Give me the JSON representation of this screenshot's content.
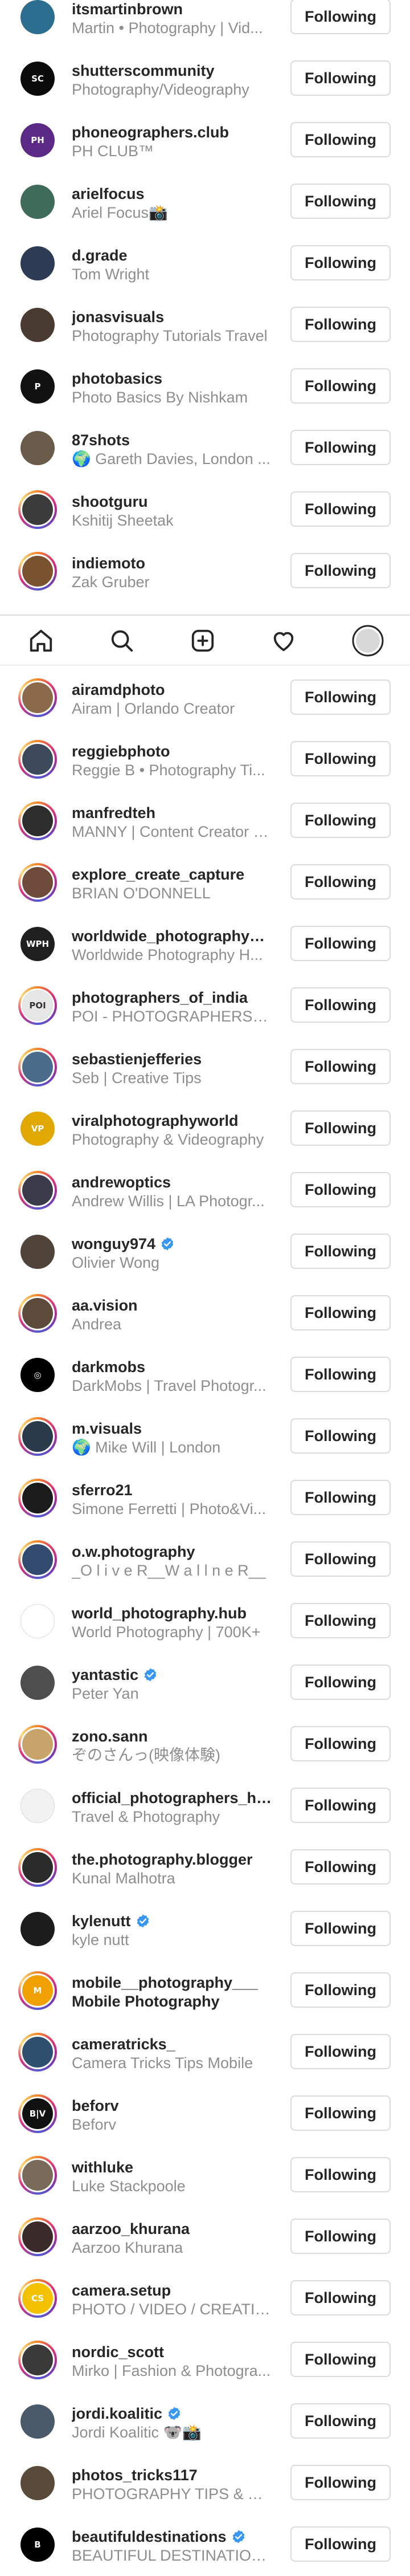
{
  "button_label": "Following",
  "colors": {
    "story_ring": [
      "#f58529",
      "#dd2a7b",
      "#8134af",
      "#515bd4"
    ],
    "verified": "#3897f0",
    "secondary_text": "#8e8e8e"
  },
  "tabbar": {
    "items": [
      "home-icon",
      "search-icon",
      "new-post-icon",
      "activity-heart-icon",
      "profile-avatar-icon"
    ]
  },
  "accounts_top": [
    {
      "username": "itsmartinbrown",
      "fullname": "Martin • Photography | Vid...",
      "ring": false,
      "avatar_color": "#2c6e8f",
      "avatar_text": "",
      "verified": false
    },
    {
      "username": "shutterscommunity",
      "fullname": "Photography/Videography",
      "ring": false,
      "avatar_color": "#0b0b0b",
      "avatar_text": "SC",
      "verified": false
    },
    {
      "username": "phoneographers.club",
      "fullname": "PH CLUB™",
      "ring": false,
      "avatar_color": "#5b2a86",
      "avatar_text": "PH",
      "verified": false
    },
    {
      "username": "arielfocus",
      "fullname": "Ariel Focus📸",
      "ring": false,
      "avatar_color": "#3f6b5a",
      "avatar_text": "",
      "verified": false
    },
    {
      "username": "d.grade",
      "fullname": "Tom Wright",
      "ring": false,
      "avatar_color": "#2e3b55",
      "avatar_text": "",
      "verified": false
    },
    {
      "username": "jonasvisuals",
      "fullname": "Photography Tutorials Travel",
      "ring": false,
      "avatar_color": "#4a3b32",
      "avatar_text": "",
      "verified": false
    },
    {
      "username": "photobasics",
      "fullname": "Photo Basics By Nishkam",
      "ring": false,
      "avatar_color": "#111111",
      "avatar_text": "P",
      "verified": false
    },
    {
      "username": "87shots",
      "fullname": "🌍 Gareth Davies, London ...",
      "ring": false,
      "avatar_color": "#6b5b4a",
      "avatar_text": "",
      "verified": false
    },
    {
      "username": "shootguru",
      "fullname": "Kshitij Sheetak",
      "ring": true,
      "avatar_color": "#3b3b3b",
      "avatar_text": "",
      "verified": false
    },
    {
      "username": "indiemoto",
      "fullname": "Zak Gruber",
      "ring": true,
      "avatar_color": "#7a5230",
      "avatar_text": "",
      "verified": false
    }
  ],
  "accounts_bottom": [
    {
      "username": "airamdphoto",
      "fullname": "Airam | Orlando Creator",
      "ring": true,
      "avatar_color": "#8a6a4a",
      "avatar_text": "",
      "verified": false
    },
    {
      "username": "reggiebphoto",
      "fullname": "Reggie B • Photography Ti...",
      "ring": true,
      "avatar_color": "#3d4a5c",
      "avatar_text": "",
      "verified": false
    },
    {
      "username": "manfredteh",
      "fullname": "MANNY | Content Creator | ...",
      "ring": true,
      "avatar_color": "#2d2d2d",
      "avatar_text": "",
      "verified": false
    },
    {
      "username": "explore_create_capture",
      "fullname": "BRIAN O'DONNELL",
      "ring": true,
      "avatar_color": "#6e4b3a",
      "avatar_text": "",
      "verified": false
    },
    {
      "username": "worldwide_photography_hub",
      "fullname": "Worldwide Photography H...",
      "ring": false,
      "avatar_color": "#1f1f1f",
      "avatar_text": "WPH",
      "verified": false
    },
    {
      "username": "photographers_of_india",
      "fullname": "POI - PHOTOGRAPHERS O...",
      "ring": true,
      "avatar_color": "#e7e7e7",
      "avatar_text": "POI",
      "verified": false
    },
    {
      "username": "sebastienjefferies",
      "fullname": "Seb | Creative Tips",
      "ring": true,
      "avatar_color": "#4b6b8a",
      "avatar_text": "",
      "verified": false
    },
    {
      "username": "viralphotographyworld",
      "fullname": "Photography & Videography",
      "ring": false,
      "avatar_color": "#e0a800",
      "avatar_text": "VP",
      "verified": false
    },
    {
      "username": "andrewoptics",
      "fullname": "Andrew Willis | LA Photogr...",
      "ring": true,
      "avatar_color": "#3a3a4a",
      "avatar_text": "",
      "verified": false
    },
    {
      "username": "wonguy974",
      "fullname": "Olivier Wong",
      "ring": false,
      "avatar_color": "#50433a",
      "avatar_text": "",
      "verified": true
    },
    {
      "username": "aa.vision",
      "fullname": "Andrea",
      "ring": true,
      "avatar_color": "#5c4a3a",
      "avatar_text": "",
      "verified": false
    },
    {
      "username": "darkmobs",
      "fullname": "DarkMobs | Travel Photogr...",
      "ring": false,
      "avatar_color": "#000000",
      "avatar_text": "◎",
      "verified": false
    },
    {
      "username": "m.visuals",
      "fullname": "🌍 Mike Will | London",
      "ring": true,
      "avatar_color": "#2a3a4a",
      "avatar_text": "",
      "verified": false
    },
    {
      "username": "sferro21",
      "fullname": "Simone Ferretti | Photo&Vi...",
      "ring": true,
      "avatar_color": "#1b1b1b",
      "avatar_text": "",
      "verified": false
    },
    {
      "username": "o.w.photography",
      "fullname": "_O l i v e R__W a l l n e R__",
      "ring": true,
      "avatar_color": "#324a6e",
      "avatar_text": "",
      "verified": false
    },
    {
      "username": "world_photography.hub",
      "fullname": "World Photography | 700K+",
      "ring": false,
      "avatar_color": "#ffffff",
      "avatar_text": "",
      "verified": false
    },
    {
      "username": "yantastic",
      "fullname": "Peter Yan",
      "ring": false,
      "avatar_color": "#4e4e4e",
      "avatar_text": "",
      "verified": true
    },
    {
      "username": "zono.sann",
      "fullname": "ぞのさんっ(映像体験)",
      "ring": true,
      "avatar_color": "#c9a46a",
      "avatar_text": "",
      "verified": false
    },
    {
      "username": "official_photographers_hub",
      "fullname": "Travel & Photography",
      "ring": false,
      "avatar_color": "#f2f2f2",
      "avatar_text": "",
      "verified": false
    },
    {
      "username": "the.photography.blogger",
      "fullname": "Kunal Malhotra",
      "ring": true,
      "avatar_color": "#2b2b2b",
      "avatar_text": "",
      "verified": false
    },
    {
      "username": "kylenutt",
      "fullname": "kyle nutt",
      "ring": false,
      "avatar_color": "#1c1c1c",
      "avatar_text": "",
      "verified": true
    },
    {
      "username": "mobile__photography___",
      "fullname": "Mobile Photography",
      "fullname_bold": true,
      "ring": true,
      "avatar_color": "#f0a000",
      "avatar_text": "M",
      "verified": false
    },
    {
      "username": "cameratricks_",
      "fullname": "Camera Tricks Tips Mobile",
      "ring": true,
      "avatar_color": "#2f4f6f",
      "avatar_text": "",
      "verified": false
    },
    {
      "username": "beforv",
      "fullname": "Beforv",
      "ring": true,
      "avatar_color": "#111111",
      "avatar_text": "B|V",
      "verified": false
    },
    {
      "username": "withluke",
      "fullname": "Luke Stackpoole",
      "ring": true,
      "avatar_color": "#7a6a5a",
      "avatar_text": "",
      "verified": false
    },
    {
      "username": "aarzoo_khurana",
      "fullname": "Aarzoo Khurana",
      "ring": true,
      "avatar_color": "#3a2a2a",
      "avatar_text": "",
      "verified": false
    },
    {
      "username": "camera.setup",
      "fullname": "PHOTO / VIDEO / CREATIV...",
      "ring": true,
      "avatar_color": "#f2c200",
      "avatar_text": "CS",
      "verified": false
    },
    {
      "username": "nordic_scott",
      "fullname": "Mirko | Fashion & Photogra...",
      "ring": true,
      "avatar_color": "#3a3a3a",
      "avatar_text": "",
      "verified": false
    },
    {
      "username": "jordi.koalitic",
      "fullname": "Jordi Koalitic 🐨📸",
      "ring": false,
      "avatar_color": "#4a5a6a",
      "avatar_text": "",
      "verified": true
    },
    {
      "username": "photos_tricks117",
      "fullname": "PHOTOGRAPHY TIPS & TR...",
      "ring": false,
      "avatar_color": "#5a4a3a",
      "avatar_text": "",
      "verified": false
    },
    {
      "username": "beautifuldestinations",
      "fullname": "BEAUTIFUL DESTINATIONS",
      "ring": false,
      "avatar_color": "#000000",
      "avatar_text": "B",
      "verified": true
    }
  ]
}
